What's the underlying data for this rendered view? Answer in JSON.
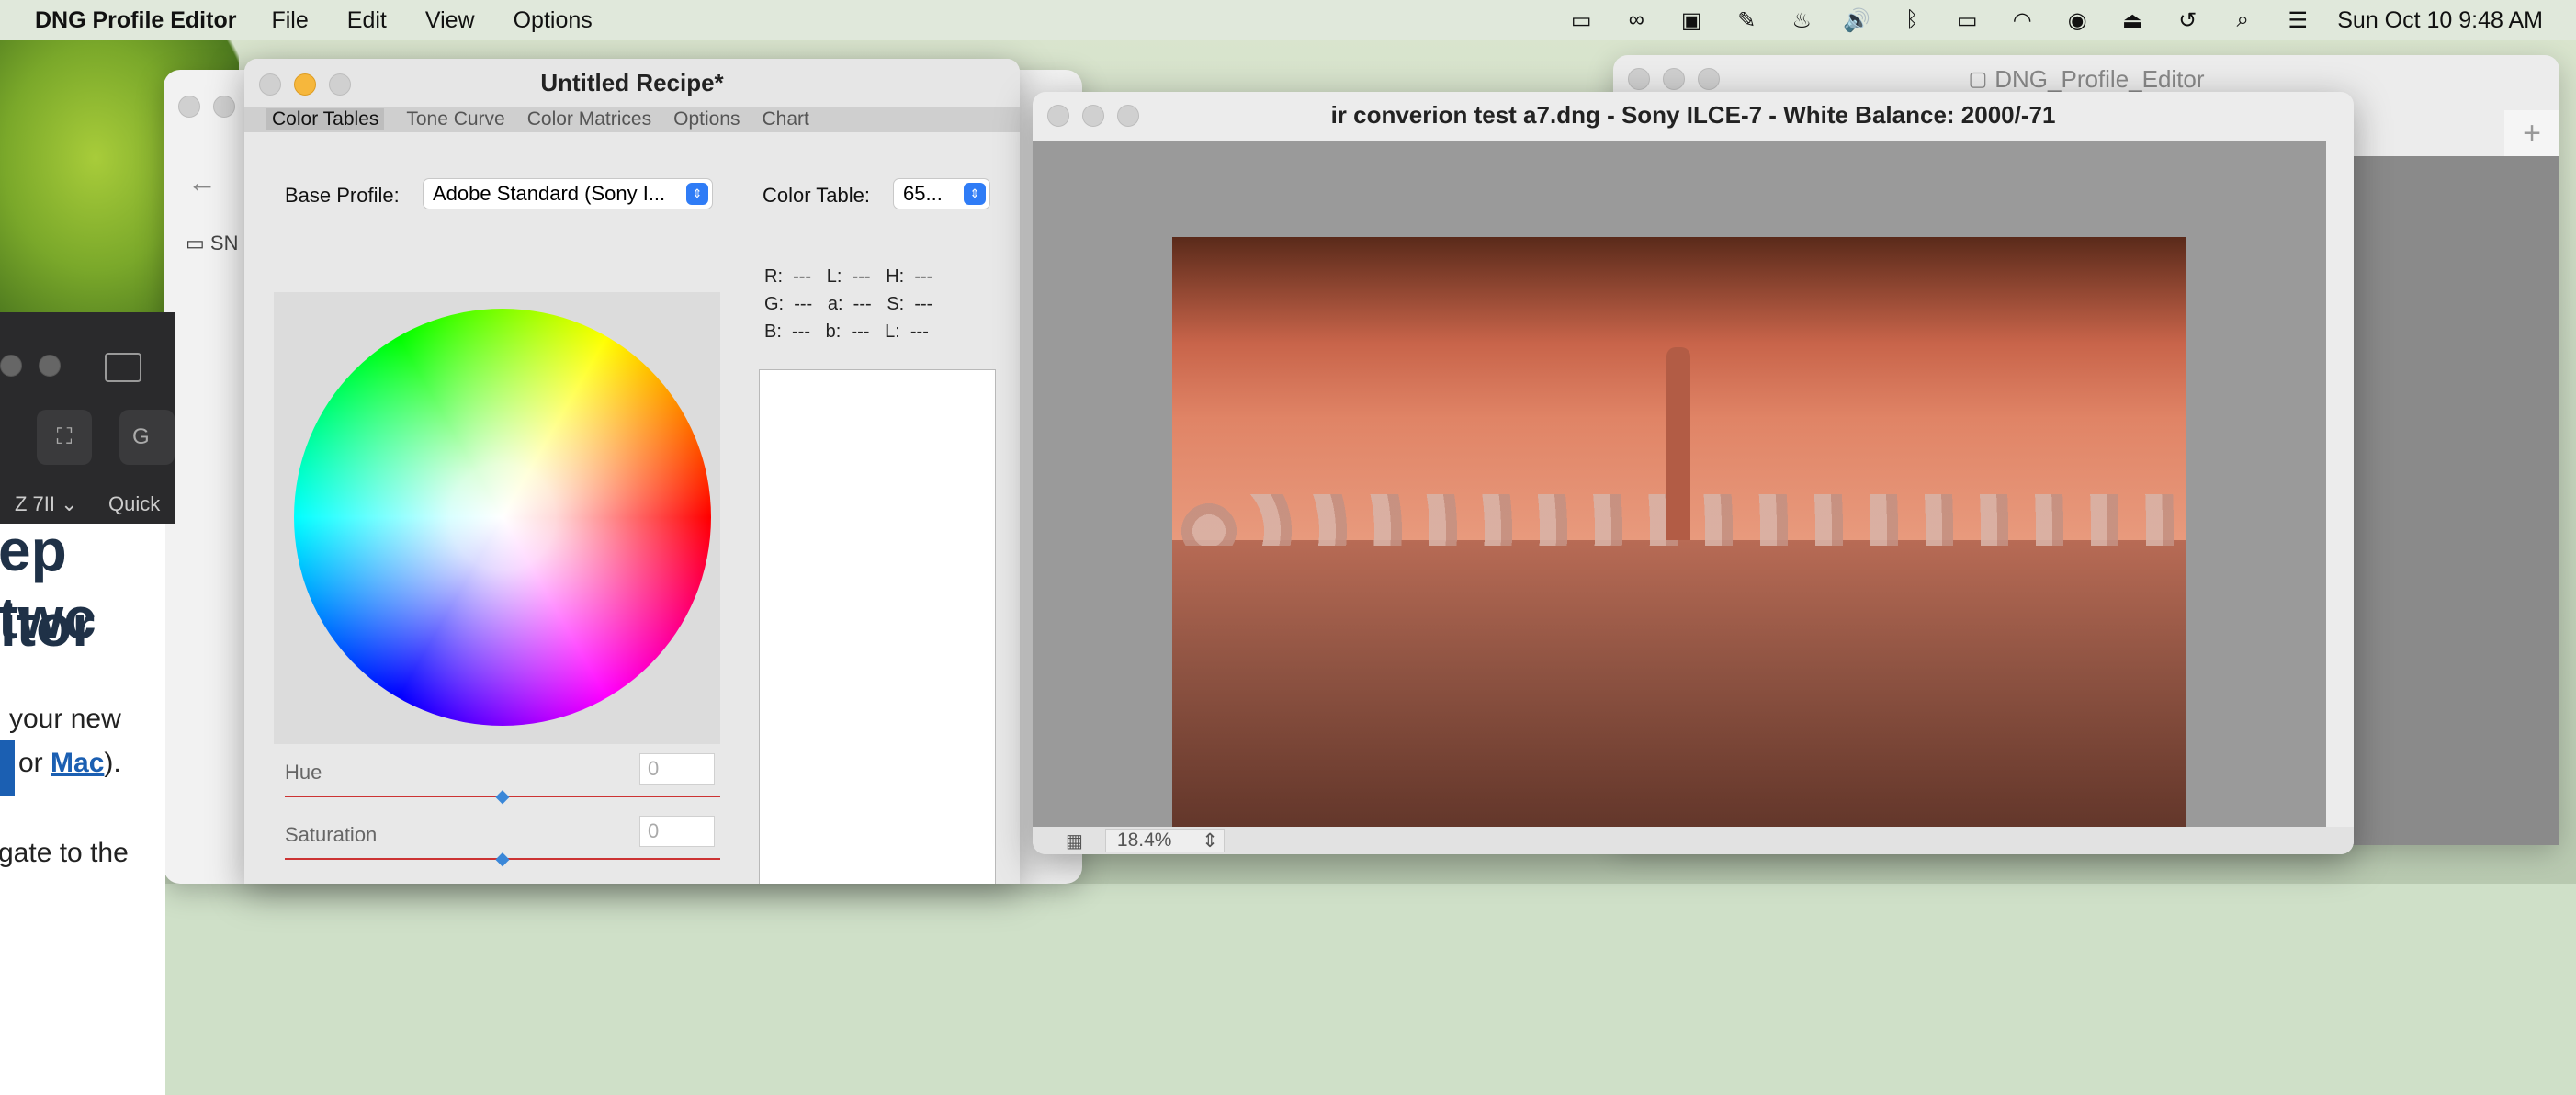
{
  "menubar": {
    "app_name": "DNG Profile Editor",
    "items": [
      "File",
      "Edit",
      "View",
      "Options"
    ],
    "clock": "Sun Oct 10  9:48 AM"
  },
  "finder_window": {
    "title": "DNG_Profile_Editor"
  },
  "web_page": {
    "heading_line1": "ep twc",
    "heading_line2": "itor",
    "body_line1": "your new",
    "body_line2_prefix": "or ",
    "body_link": "Mac",
    "body_line2_suffix": ").",
    "body_line3": "gate to the",
    "toolbar_model": "Z 7II",
    "toolbar_quick": "Quick",
    "folder_label": "SN"
  },
  "recipe_window": {
    "title": "Untitled Recipe*",
    "tabs": [
      "Color Tables",
      "Tone Curve",
      "Color Matrices",
      "Options",
      "Chart"
    ],
    "base_profile_label": "Base Profile:",
    "base_profile_value": "Adobe Standard (Sony I...",
    "color_table_label": "Color Table:",
    "color_table_value": "65...",
    "readout": {
      "row1": "R:  ---   L:  ---   H:  ---",
      "row2": "G:  ---   a:  ---   S:  ---",
      "row3": "B:  ---   b:  ---   L:  ---"
    },
    "hue_label": "Hue",
    "hue_value": "0",
    "hue_level": 0.5,
    "saturation_label": "Saturation",
    "saturation_value": "0",
    "saturation_level": 0.5
  },
  "image_window": {
    "title": "ir converion test a7.dng  - Sony ILCE-7 - White Balance: 2000/-71",
    "zoom": "18.4%"
  },
  "colors": {
    "accent": "#2f7cf6",
    "image_tone": "#e08466"
  }
}
